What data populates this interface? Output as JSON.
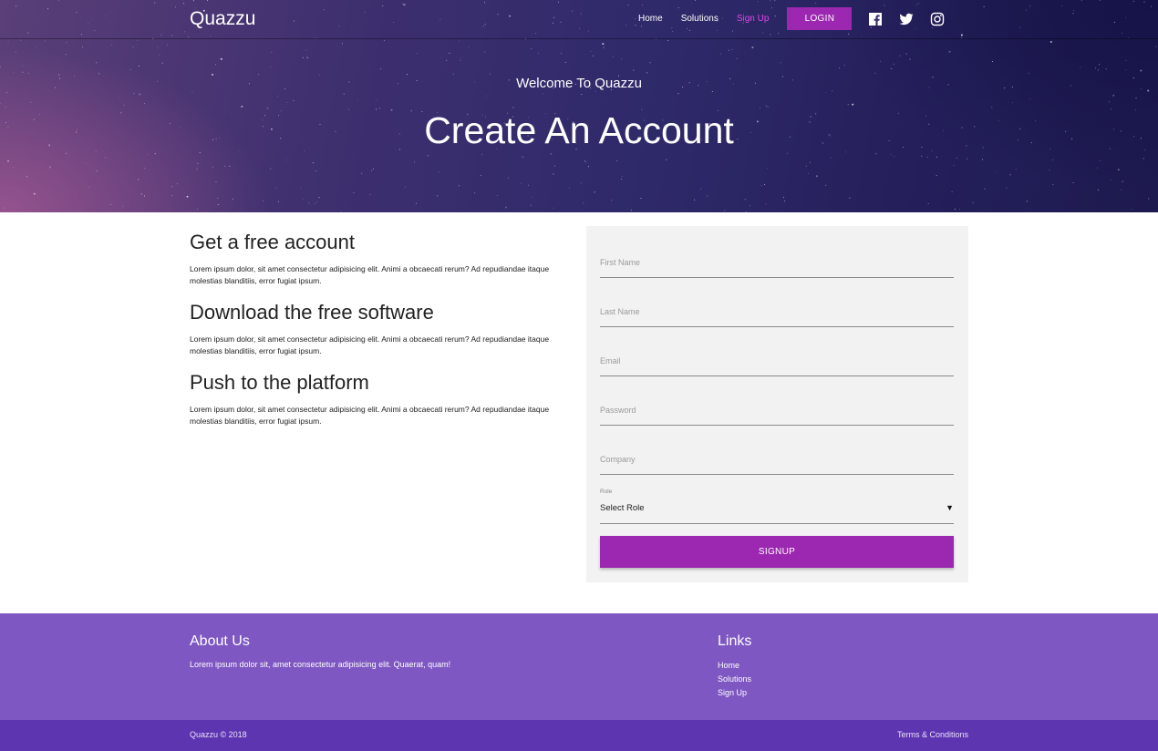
{
  "header": {
    "brand": "Quazzu",
    "nav": {
      "home": "Home",
      "solutions": "Solutions",
      "signup": "Sign Up",
      "login": "LOGIN"
    },
    "accent_color": "#9c27b0",
    "active_link_color": "#e046e8",
    "social_icons": [
      "facebook-icon",
      "twitter-icon",
      "instagram-icon"
    ]
  },
  "hero": {
    "subtitle": "Welcome To Quazzu",
    "title": "Create An Account"
  },
  "features": [
    {
      "title": "Get a free account",
      "text": "Lorem ipsum dolor, sit amet consectetur adipisicing elit. Animi a obcaecati rerum? Ad repudiandae itaque molestias blanditiis, error fugiat ipsum."
    },
    {
      "title": "Download the free software",
      "text": "Lorem ipsum dolor, sit amet consectetur adipisicing elit. Animi a obcaecati rerum? Ad repudiandae itaque molestias blanditiis, error fugiat ipsum."
    },
    {
      "title": "Push to the platform",
      "text": "Lorem ipsum dolor, sit amet consectetur adipisicing elit. Animi a obcaecati rerum? Ad repudiandae itaque molestias blanditiis, error fugiat ipsum."
    }
  ],
  "form": {
    "first_name": {
      "placeholder": "First Name",
      "value": ""
    },
    "last_name": {
      "placeholder": "Last Name",
      "value": ""
    },
    "email": {
      "placeholder": "Email",
      "value": ""
    },
    "password": {
      "placeholder": "Password",
      "value": ""
    },
    "company": {
      "placeholder": "Company",
      "value": ""
    },
    "role": {
      "label": "Role",
      "selected": "Select Role",
      "caret": "▼"
    },
    "submit_label": "SIGNUP"
  },
  "footer": {
    "about_title": "About Us",
    "about_text": "Lorem ipsum dolor sit, amet consectetur adipisicing elit. Quaerat, quam!",
    "links_title": "Links",
    "links": [
      "Home",
      "Solutions",
      "Sign Up"
    ],
    "copyright": "Quazzu © 2018",
    "terms": "Terms & Conditions",
    "footer_color": "#7e57c2",
    "bottom_bar_color": "#5e35b1"
  }
}
